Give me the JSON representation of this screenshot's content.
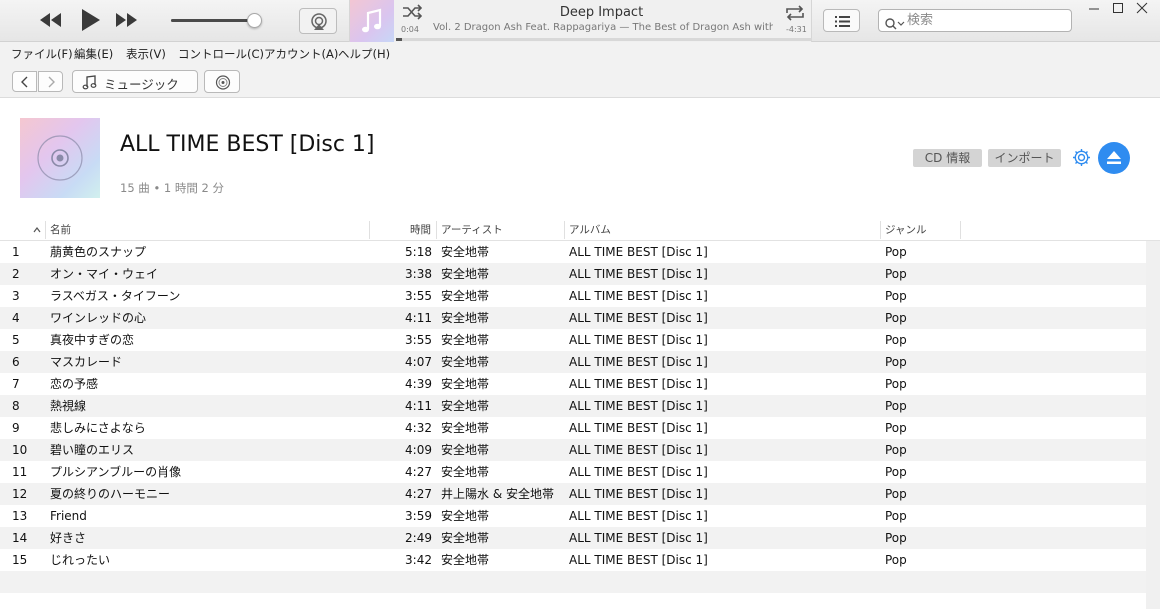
{
  "player": {
    "now_playing_title": "Deep Impact",
    "now_playing_subtitle": "Vol. 2   Dragon Ash Feat. Rappagariya — The Best of Dragon Ash with",
    "elapsed": "0:04",
    "remaining": "-4:31",
    "progress_fraction": 0.015,
    "volume_fraction": 0.95
  },
  "search": {
    "placeholder": "検索"
  },
  "menu": [
    "ファイル(F)",
    "編集(E)",
    "表示(V)",
    "コントロール(C)",
    "アカウント(A)",
    "ヘルプ(H)"
  ],
  "nav": {
    "media_label": "ミュージック"
  },
  "album": {
    "title": "ALL TIME BEST [Disc 1]",
    "meta": "15 曲 • 1 時間 2 分",
    "cd_info_label": "CD 情報",
    "import_label": "インポート"
  },
  "columns": {
    "name": "名前",
    "time": "時間",
    "artist": "アーティスト",
    "album": "アルバム",
    "genre": "ジャンル"
  },
  "tracks": [
    {
      "num": "1",
      "name": "萠黄色のスナップ",
      "time": "5:18",
      "artist": "安全地帯",
      "album": "ALL TIME BEST [Disc 1]",
      "genre": "Pop"
    },
    {
      "num": "2",
      "name": "オン・マイ・ウェイ",
      "time": "3:38",
      "artist": "安全地帯",
      "album": "ALL TIME BEST [Disc 1]",
      "genre": "Pop"
    },
    {
      "num": "3",
      "name": "ラスベガス・タイフーン",
      "time": "3:55",
      "artist": "安全地帯",
      "album": "ALL TIME BEST [Disc 1]",
      "genre": "Pop"
    },
    {
      "num": "4",
      "name": "ワインレッドの心",
      "time": "4:11",
      "artist": "安全地帯",
      "album": "ALL TIME BEST [Disc 1]",
      "genre": "Pop"
    },
    {
      "num": "5",
      "name": "真夜中すぎの恋",
      "time": "3:55",
      "artist": "安全地帯",
      "album": "ALL TIME BEST [Disc 1]",
      "genre": "Pop"
    },
    {
      "num": "6",
      "name": "マスカレード",
      "time": "4:07",
      "artist": "安全地帯",
      "album": "ALL TIME BEST [Disc 1]",
      "genre": "Pop"
    },
    {
      "num": "7",
      "name": "恋の予感",
      "time": "4:39",
      "artist": "安全地帯",
      "album": "ALL TIME BEST [Disc 1]",
      "genre": "Pop"
    },
    {
      "num": "8",
      "name": "熱視線",
      "time": "4:11",
      "artist": "安全地帯",
      "album": "ALL TIME BEST [Disc 1]",
      "genre": "Pop"
    },
    {
      "num": "9",
      "name": "悲しみにさよなら",
      "time": "4:32",
      "artist": "安全地帯",
      "album": "ALL TIME BEST [Disc 1]",
      "genre": "Pop"
    },
    {
      "num": "10",
      "name": "碧い瞳のエリス",
      "time": "4:09",
      "artist": "安全地帯",
      "album": "ALL TIME BEST [Disc 1]",
      "genre": "Pop"
    },
    {
      "num": "11",
      "name": "プルシアンブルーの肖像",
      "time": "4:27",
      "artist": "安全地帯",
      "album": "ALL TIME BEST [Disc 1]",
      "genre": "Pop"
    },
    {
      "num": "12",
      "name": "夏の終りのハーモニー",
      "time": "4:27",
      "artist": "井上陽水 & 安全地帯",
      "album": "ALL TIME BEST [Disc 1]",
      "genre": "Pop"
    },
    {
      "num": "13",
      "name": "Friend",
      "time": "3:59",
      "artist": "安全地帯",
      "album": "ALL TIME BEST [Disc 1]",
      "genre": "Pop"
    },
    {
      "num": "14",
      "name": "好きさ",
      "time": "2:49",
      "artist": "安全地帯",
      "album": "ALL TIME BEST [Disc 1]",
      "genre": "Pop"
    },
    {
      "num": "15",
      "name": "じれったい",
      "time": "3:42",
      "artist": "安全地帯",
      "album": "ALL TIME BEST [Disc 1]",
      "genre": "Pop"
    }
  ],
  "colors": {
    "accent": "#2f8cf0"
  }
}
